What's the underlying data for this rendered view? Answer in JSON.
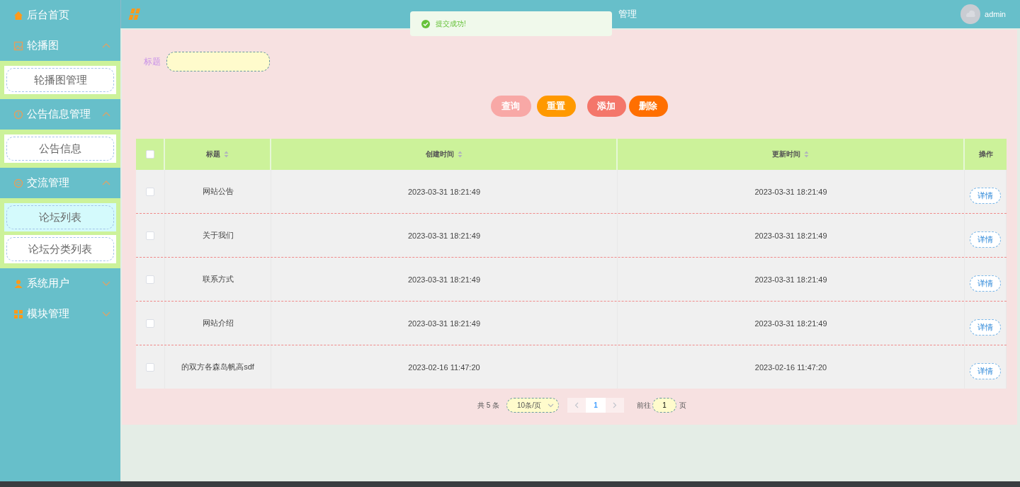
{
  "header": {
    "title": "管理",
    "user": "admin"
  },
  "toast": {
    "message": "提交成功!"
  },
  "sidebar": {
    "items": [
      {
        "kind": "link",
        "label": "后台首页"
      },
      {
        "kind": "group",
        "label": "轮播图",
        "expanded": true,
        "children": [
          {
            "label": "轮播图管理",
            "selected": false
          }
        ]
      },
      {
        "kind": "group",
        "label": "公告信息管理",
        "expanded": true,
        "children": [
          {
            "label": "公告信息",
            "selected": false
          }
        ]
      },
      {
        "kind": "group",
        "label": "交流管理",
        "expanded": true,
        "children": [
          {
            "label": "论坛列表",
            "selected": true
          },
          {
            "label": "论坛分类列表",
            "selected": false
          }
        ]
      },
      {
        "kind": "group",
        "label": "系统用户",
        "expanded": false
      },
      {
        "kind": "group",
        "label": "模块管理",
        "expanded": false
      }
    ]
  },
  "search": {
    "label": "标题"
  },
  "buttons": [
    {
      "label": "查询",
      "kind": "search"
    },
    {
      "label": "重置",
      "kind": "reset"
    },
    {
      "label": "添加",
      "kind": "add"
    },
    {
      "label": "删除",
      "kind": "delete"
    }
  ],
  "table": {
    "select_all": {
      "checked": false
    },
    "columns": [
      {
        "label": "标题",
        "sortable": true
      },
      {
        "label": "创建时间",
        "sortable": true
      },
      {
        "label": "更新时间",
        "sortable": true
      },
      {
        "label": "操作",
        "sortable": false
      }
    ],
    "rows": [
      {
        "checked": false,
        "title": "网站公告",
        "created": "2023-03-31 18:21:49",
        "updated": "2023-03-31 18:21:49",
        "action": "详情"
      },
      {
        "checked": false,
        "title": "关于我们",
        "created": "2023-03-31 18:21:49",
        "updated": "2023-03-31 18:21:49",
        "action": "详情"
      },
      {
        "checked": false,
        "title": "联系方式",
        "created": "2023-03-31 18:21:49",
        "updated": "2023-03-31 18:21:49",
        "action": "详情"
      },
      {
        "checked": false,
        "title": "网站介绍",
        "created": "2023-03-31 18:21:49",
        "updated": "2023-03-31 18:21:49",
        "action": "详情"
      },
      {
        "checked": false,
        "title": "的双方各森岛帆高sdf",
        "created": "2023-02-16 11:47:20",
        "updated": "2023-02-16 11:47:20",
        "action": "详情"
      }
    ]
  },
  "pagination": {
    "total": "共 5 条",
    "page_size": "10条/页",
    "pages": [
      {
        "label": "1",
        "selected": true
      }
    ],
    "goto_label": "前往",
    "goto_value": "1",
    "goto_suffix": "页"
  }
}
